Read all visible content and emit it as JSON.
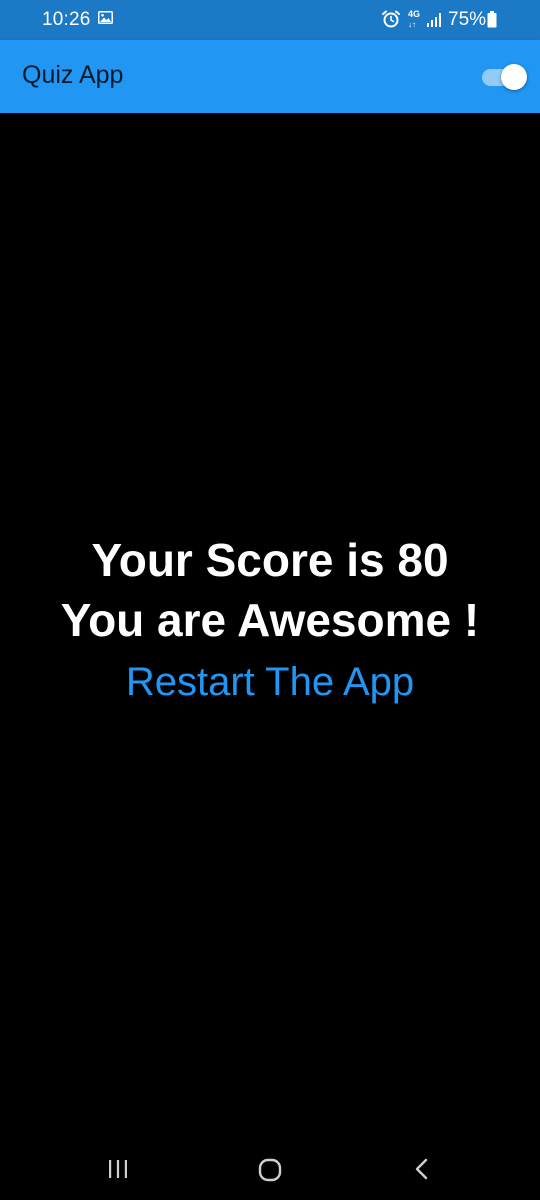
{
  "status_bar": {
    "time": "10:26",
    "network": "4G",
    "battery": "75%"
  },
  "app_bar": {
    "title": "Quiz App",
    "theme_toggle_on": true
  },
  "result": {
    "score_text": "Your Score is 80",
    "message": "You are Awesome !",
    "restart_label": "Restart The App"
  },
  "nav_bar": {
    "buttons": [
      "recents",
      "home",
      "back"
    ]
  },
  "colors": {
    "status_bar_bg": "#1c79c6",
    "app_bar_bg": "#2196f3",
    "background": "#000000",
    "accent": "#2196f3",
    "toggle_track": "#90cbf9"
  }
}
